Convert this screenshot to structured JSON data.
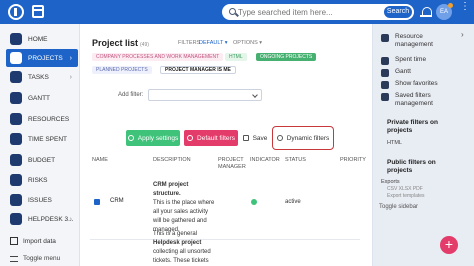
{
  "topbar": {
    "search_placeholder": "Type searched item here...",
    "search_button": "Search",
    "avatar_initials": "EA"
  },
  "sidebar": {
    "items": [
      {
        "label": "HOME",
        "icon": "home-icon"
      },
      {
        "label": "PROJECTS",
        "icon": "projects-icon",
        "active": true
      },
      {
        "label": "TASKS",
        "icon": "tasks-icon"
      },
      {
        "label": "GANTT",
        "icon": "gantt-icon"
      },
      {
        "label": "RESOURCES",
        "icon": "resources-icon"
      },
      {
        "label": "TIME SPENT",
        "icon": "clock-icon"
      },
      {
        "label": "BUDGET",
        "icon": "budget-icon"
      },
      {
        "label": "RISKS",
        "icon": "risks-icon"
      },
      {
        "label": "ISSUES",
        "icon": "issues-icon"
      },
      {
        "label": "HELPDESK 3...",
        "icon": "helpdesk-icon"
      }
    ],
    "import_label": "Import data",
    "toggle_label": "Toggle menu"
  },
  "main": {
    "title": "Project list",
    "count": "(49)",
    "filters_label": "FILTERS",
    "filters_default": "DEFAULT ▾",
    "options_label": "OPTIONS ▾",
    "chips": [
      "COMPANY PROCESSES AND WORK MANAGEMENT",
      "HTML",
      "ONGOING PROJECTS",
      "PLANNED PROJECTS",
      "PROJECT MANAGER IS ME"
    ],
    "add_filter_label": "Add filter:",
    "buttons": {
      "apply": "Apply settings",
      "default": "Default filters",
      "save": "Save",
      "dynamic": "Dynamic filters"
    },
    "columns": [
      "NAME",
      "DESCRIPTION",
      "PROJECT MANAGER",
      "INDICATOR",
      "STATUS",
      "PRIORITY"
    ],
    "rows": [
      {
        "name": "CRM",
        "desc_lines": [
          "CRM project structure.",
          "This is the place where",
          "all your sales activity",
          "will be gathered and",
          "managed."
        ],
        "status": "active"
      }
    ],
    "row2_desc_lines": [
      "This is a general",
      "Helpdesk project",
      "collecting all unsorted",
      "tickets. These tickets"
    ]
  },
  "right_sidebar": {
    "items": [
      {
        "label": "Resource management",
        "icon": "resource-management-icon"
      },
      {
        "label": "Spent time",
        "icon": "spent-time-icon"
      },
      {
        "label": "Gantt",
        "icon": "gantt-icon"
      },
      {
        "label": "Show favorites",
        "icon": "star-icon"
      },
      {
        "label": "Saved filters management",
        "icon": "filter-icon"
      }
    ],
    "private_filters_title": "Private filters on projects",
    "private_filter_html": "HTML",
    "public_filters_title": "Public filters on projects",
    "exports_label": "Exports",
    "exports_formats": "CSV  XLSX  PDF",
    "exports_templates": "Export templates",
    "toggle_sidebar": "Toggle sidebar"
  },
  "colors": {
    "brand": "#1e64c8",
    "apply": "#3fc27a",
    "default": "#e33b6a",
    "highlight": "#c8383a"
  }
}
